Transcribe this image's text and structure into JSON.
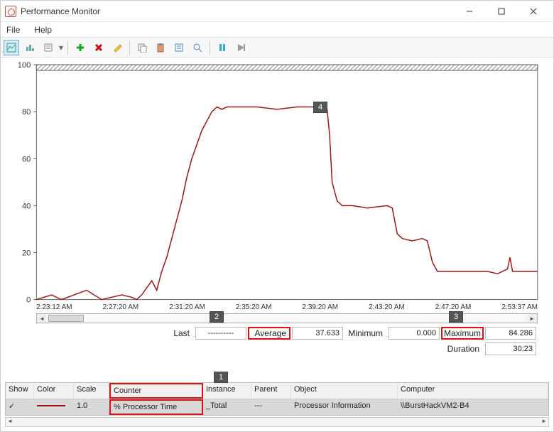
{
  "title": "Performance Monitor",
  "menus": {
    "file": "File",
    "help": "Help"
  },
  "chart_data": {
    "type": "line",
    "ylim": [
      0,
      100
    ],
    "yticks": [
      0,
      20,
      40,
      60,
      80,
      100
    ],
    "xticks": [
      "2:23:12 AM",
      "2:27:20 AM",
      "2:31:20 AM",
      "2:35:20 AM",
      "2:39:20 AM",
      "2:43:20 AM",
      "2:47:20 AM",
      "2:53:37 AM"
    ],
    "series": [
      {
        "name": "% Processor Time",
        "color": "#a01818",
        "points": [
          [
            0.0,
            0
          ],
          [
            0.03,
            2
          ],
          [
            0.05,
            0
          ],
          [
            0.1,
            4
          ],
          [
            0.13,
            0
          ],
          [
            0.17,
            2
          ],
          [
            0.19,
            1
          ],
          [
            0.2,
            0
          ],
          [
            0.21,
            2
          ],
          [
            0.23,
            8
          ],
          [
            0.24,
            4
          ],
          [
            0.25,
            12
          ],
          [
            0.26,
            18
          ],
          [
            0.27,
            26
          ],
          [
            0.28,
            34
          ],
          [
            0.29,
            42
          ],
          [
            0.3,
            52
          ],
          [
            0.31,
            60
          ],
          [
            0.32,
            66
          ],
          [
            0.33,
            72
          ],
          [
            0.34,
            76
          ],
          [
            0.35,
            80
          ],
          [
            0.36,
            82
          ],
          [
            0.37,
            81
          ],
          [
            0.38,
            82
          ],
          [
            0.4,
            82
          ],
          [
            0.44,
            82
          ],
          [
            0.48,
            81
          ],
          [
            0.52,
            82
          ],
          [
            0.56,
            82
          ],
          [
            0.58,
            81
          ],
          [
            0.585,
            70
          ],
          [
            0.59,
            50
          ],
          [
            0.6,
            42
          ],
          [
            0.61,
            40
          ],
          [
            0.63,
            40
          ],
          [
            0.66,
            39
          ],
          [
            0.7,
            40
          ],
          [
            0.71,
            39
          ],
          [
            0.72,
            28
          ],
          [
            0.73,
            26
          ],
          [
            0.75,
            25
          ],
          [
            0.77,
            26
          ],
          [
            0.78,
            25
          ],
          [
            0.79,
            16
          ],
          [
            0.8,
            12
          ],
          [
            0.82,
            12
          ],
          [
            0.85,
            12
          ],
          [
            0.9,
            12
          ],
          [
            0.92,
            11
          ],
          [
            0.94,
            13
          ],
          [
            0.945,
            18
          ],
          [
            0.95,
            12
          ],
          [
            0.97,
            12
          ],
          [
            1.0,
            12
          ]
        ]
      }
    ]
  },
  "stats": {
    "last_label": "Last",
    "last_value": "----------",
    "average_label": "Average",
    "average_value": "37.633",
    "minimum_label": "Minimum",
    "minimum_value": "0.000",
    "maximum_label": "Maximum",
    "maximum_value": "84.286",
    "duration_label": "Duration",
    "duration_value": "30:23"
  },
  "grid": {
    "headers": {
      "show": "Show",
      "color": "Color",
      "scale": "Scale",
      "counter": "Counter",
      "instance": "Instance",
      "parent": "Parent",
      "object": "Object",
      "computer": "Computer"
    },
    "row": {
      "show": "✓",
      "scale": "1.0",
      "counter": "% Processor Time",
      "instance": "_Total",
      "parent": "---",
      "object": "Processor Information",
      "computer": "\\\\BurstHackVM2-B4"
    }
  },
  "badges": {
    "b1": "1",
    "b2": "2",
    "b3": "3",
    "b4": "4"
  }
}
